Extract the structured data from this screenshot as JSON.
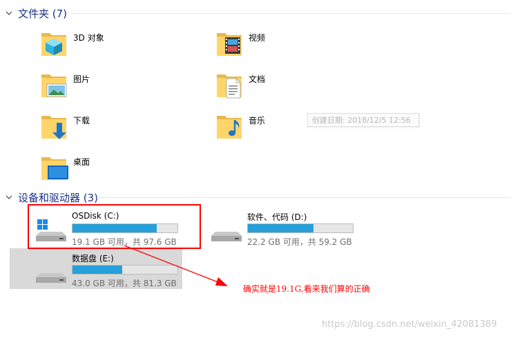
{
  "folders_section": {
    "title": "文件夹 (7)"
  },
  "folders": [
    {
      "name": "3D 对象",
      "icon": "3d-objects-folder-icon"
    },
    {
      "name": "视频",
      "icon": "videos-folder-icon"
    },
    {
      "name": "图片",
      "icon": "pictures-folder-icon"
    },
    {
      "name": "文档",
      "icon": "documents-folder-icon"
    },
    {
      "name": "下载",
      "icon": "downloads-folder-icon"
    },
    {
      "name": "音乐",
      "icon": "music-folder-icon"
    },
    {
      "name": "桌面",
      "icon": "desktop-folder-icon"
    }
  ],
  "tooltip": {
    "text": "创建日期: 2018/12/5 12:56"
  },
  "drives_section": {
    "title": "设备和驱动器 (3)"
  },
  "drives": [
    {
      "name": "OSDisk (C:)",
      "free_text": "19.1 GB 可用，共 97.6 GB",
      "used_fraction": 0.804
    },
    {
      "name": "软件、代码 (D:)",
      "free_text": "22.2 GB 可用，共 59.2 GB",
      "used_fraction": 0.625
    },
    {
      "name": "数据盘 (E:)",
      "free_text": "43.0 GB 可用，共 81.3 GB",
      "used_fraction": 0.471
    }
  ],
  "annotation": {
    "text": "确实就是19.1G,看来我们算的正确"
  },
  "watermark": {
    "text": "https://blog.csdn.net/weixin_42081389"
  },
  "colors": {
    "bar_fill": "#26a0da",
    "section_title": "#1e3287",
    "annotation_red": "#ff0000",
    "hover": "#d9d9d9"
  }
}
